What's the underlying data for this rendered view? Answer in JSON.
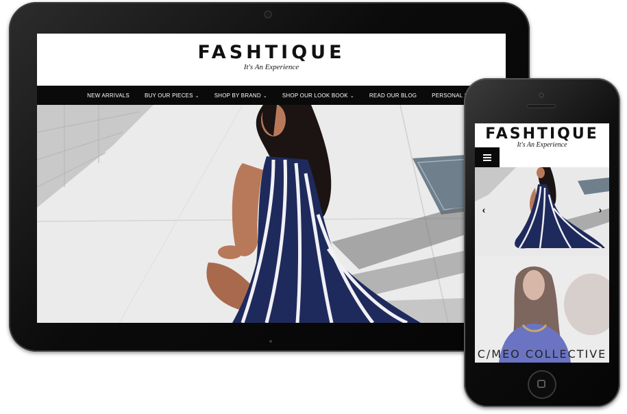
{
  "site": {
    "logo": "FASHTIQUE",
    "tagline": "It's An Experience"
  },
  "nav": {
    "items": [
      {
        "label": "NEW ARRIVALS",
        "dropdown": false
      },
      {
        "label": "BUY OUR PIECES",
        "dropdown": true
      },
      {
        "label": "SHOP BY BRAND",
        "dropdown": true
      },
      {
        "label": "SHOP OUR LOOK BOOK",
        "dropdown": true
      },
      {
        "label": "READ OUR BLOG",
        "dropdown": false
      },
      {
        "label": "PERSONAL SHOPPER",
        "dropdown": false
      }
    ]
  },
  "mobile": {
    "menu_icon": "≡",
    "prev_arrow": "‹",
    "next_arrow": "›",
    "banner_text": "C/MEO COLLECTIVE"
  },
  "colors": {
    "nav_bg": "#0a0a0a",
    "dress_navy": "#1f2a5c",
    "device_black": "#0b0b0b"
  },
  "icons": {
    "dropdown": "chevron-down-icon",
    "menu": "hamburger-menu-icon"
  }
}
